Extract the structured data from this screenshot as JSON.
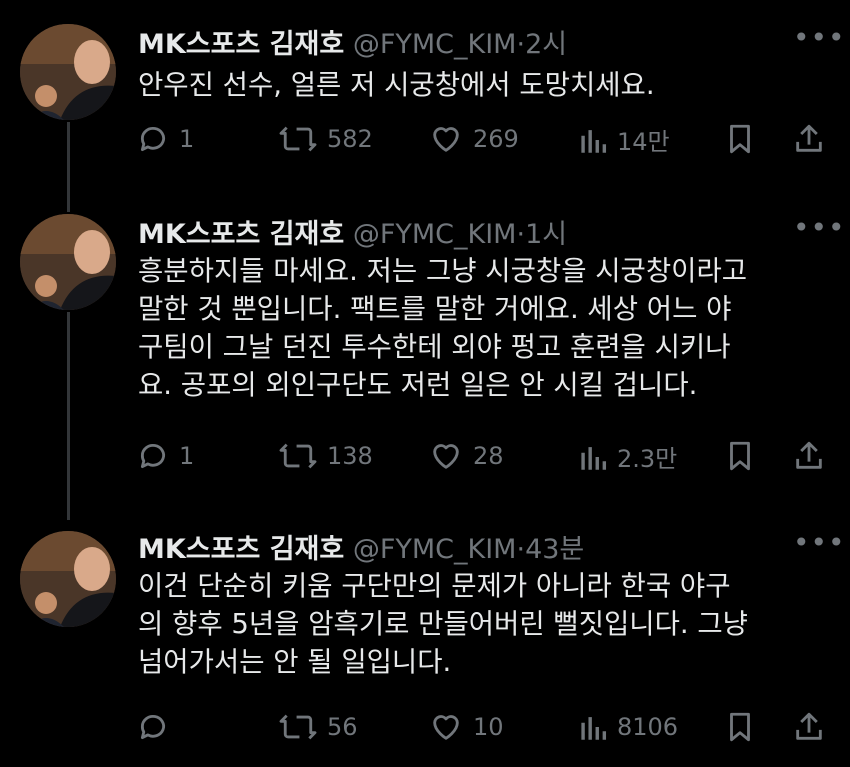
{
  "tweets": [
    {
      "name": "MK스포츠 김재호",
      "handle": "@FYMC_KIM",
      "time": "2시",
      "text_lines": [
        "안우진 선수, 얼른 저 시궁창에서 도망치세요."
      ],
      "replies": "1",
      "retweets": "582",
      "likes": "269",
      "views": "14만"
    },
    {
      "name": "MK스포츠 김재호",
      "handle": "@FYMC_KIM",
      "time": "1시",
      "text_lines": [
        "흥분하지들 마세요. 저는 그냥 시궁창을 시궁창이라고",
        "말한 것 뿐입니다. 팩트를 말한 거에요. 세상 어느 야",
        "구팀이 그날 던진 투수한테 외야 펑고 훈련을 시키나",
        "요. 공포의 외인구단도 저런 일은 안 시킬 겁니다."
      ],
      "replies": "1",
      "retweets": "138",
      "likes": "28",
      "views": "2.3만"
    },
    {
      "name": "MK스포츠 김재호",
      "handle": "@FYMC_KIM",
      "time": "43분",
      "text_lines": [
        "이건 단순히 키움 구단만의 문제가 아니라 한국 야구",
        "의 향후 5년을 암흑기로 만들어버린 뻘짓입니다. 그냥",
        "넘어가서는 안 될 일입니다."
      ],
      "replies": "",
      "retweets": "56",
      "likes": "10",
      "views": "8106"
    }
  ],
  "separator_dot": "·",
  "colors": {
    "background": "#000000",
    "text": "#e7e9ea",
    "muted": "#71767b",
    "thread_line": "#333639"
  },
  "icons": [
    "avatar-photo",
    "more-icon",
    "reply-icon",
    "retweet-icon",
    "like-icon",
    "views-icon",
    "bookmark-icon",
    "share-icon"
  ]
}
